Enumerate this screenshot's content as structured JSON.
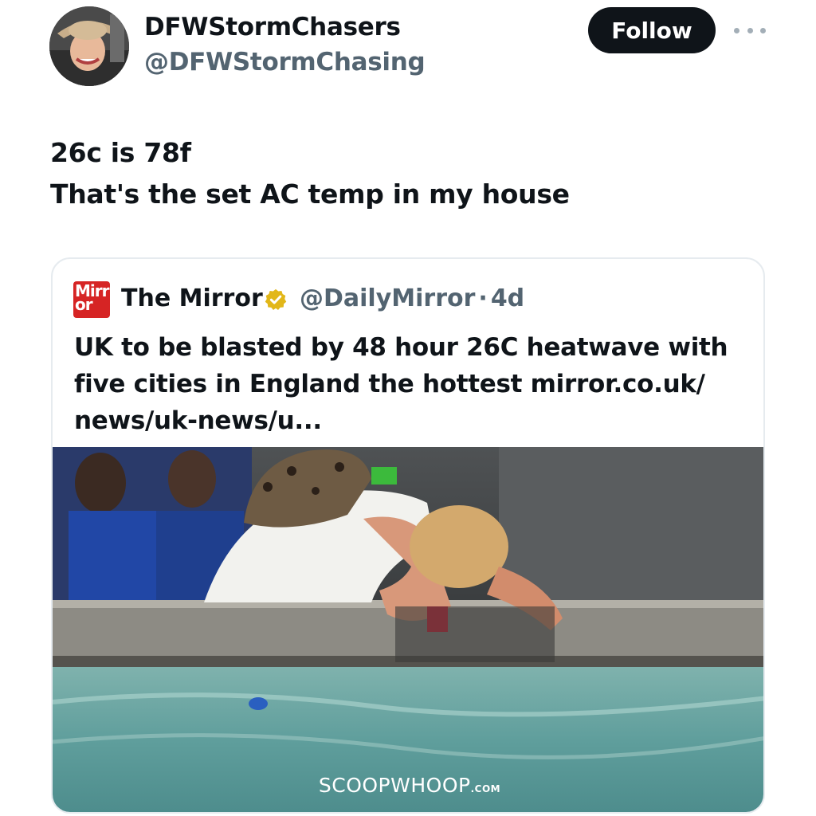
{
  "author": {
    "display_name": "DFWStormChasers",
    "handle": "@DFWStormChasing",
    "avatar_icon": "profile-photo-avatar"
  },
  "follow_label": "Follow",
  "more_icon": "more-horizontal-icon",
  "tweet": {
    "lines": [
      "26c is 78f",
      "That's the set AC temp in my house"
    ]
  },
  "quote": {
    "logo_text_top": "Mirr",
    "logo_text_bottom": "or",
    "name": "The Mirror",
    "verified_icon": "verified-badge-icon",
    "handle": "@DailyMirror",
    "separator": "·",
    "time": "4d",
    "text_lines": [
      "UK to be blasted by 48 hour 26C heatwave with",
      "five cities in England the hottest mirror.co.uk/",
      "news/uk-news/u..."
    ],
    "image_watermark": "SCOOPWHOOP",
    "image_watermark_suffix": ".COM"
  },
  "colors": {
    "follow_bg": "#0f1419",
    "handle_gray": "#536471",
    "verified_gold": "#e2b719",
    "mirror_red": "#d62424"
  }
}
